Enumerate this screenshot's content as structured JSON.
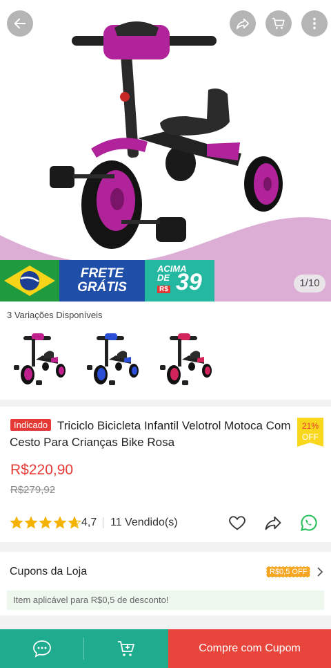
{
  "hero": {
    "image_counter": "1/10",
    "banner": {
      "frete_line1": "FRETE",
      "frete_line2": "GRÁTIS",
      "acima_line1": "ACIMA",
      "acima_line2": "DE",
      "currency": "R$",
      "amount": "39"
    }
  },
  "variants": {
    "title": "3 Variações Disponíveis",
    "colors": [
      "#c0208c",
      "#2a4fd6",
      "#d0245a"
    ]
  },
  "product": {
    "tag": "Indicado",
    "title": "Triciclo Bicicleta Infantil Velotrol Motoca Com Cesto Para Crianças Bike Rosa",
    "discount_value": "21%",
    "discount_label": "OFF",
    "price": "R$220,90",
    "old_price": "R$279,92",
    "rating": "4,7",
    "rating_stars": 4.7,
    "sold": "11 Vendido(s)"
  },
  "coupons": {
    "title": "Cupons da Loja",
    "badge": "R$0,5 OFF",
    "note": "Item aplicável para R$0,5 de desconto!"
  },
  "bottom_bar": {
    "buy_label": "Compre com Cupom"
  },
  "colors": {
    "accent_red": "#e53935",
    "bar_green": "#1fab8e",
    "buy_red": "#e8463c",
    "star": "#f5b301"
  }
}
